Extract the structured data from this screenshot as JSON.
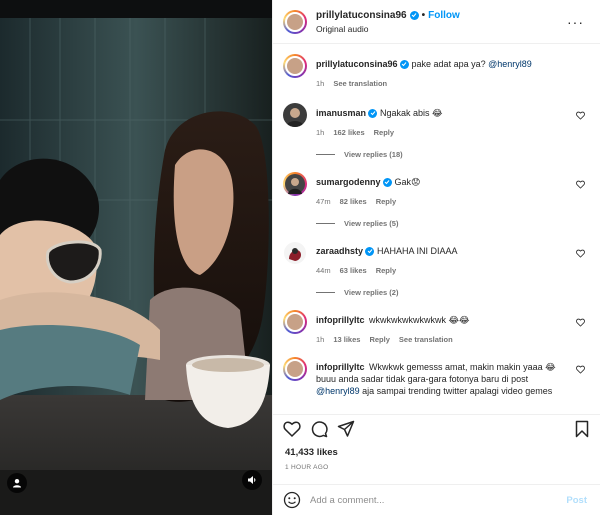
{
  "post": {
    "username": "prillylatuconsina96",
    "separator": "•",
    "follow_label": "Follow",
    "audio_label": "Original audio",
    "more_glyph": "···"
  },
  "caption": {
    "username": "prillylatuconsina96",
    "text": "pake adat apa ya? ",
    "mention": "@henryl89",
    "time": "1h",
    "see_translation": "See translation"
  },
  "comments": [
    {
      "username": "imanusman",
      "text": "Ngakak abis 😂",
      "time": "1h",
      "likes": "162 likes",
      "reply": "Reply",
      "view_replies": "View replies (18)"
    },
    {
      "username": "sumargodenny",
      "text": "Gak😟",
      "time": "47m",
      "likes": "82 likes",
      "reply": "Reply",
      "view_replies": "View replies (5)"
    },
    {
      "username": "zaraadhsty",
      "text": "HAHAHA INI DIAAA",
      "time": "44m",
      "likes": "63 likes",
      "reply": "Reply",
      "view_replies": "View replies (2)"
    },
    {
      "username": "infoprillyltc",
      "text": "wkwkwkwkwkwkwk 😂😂",
      "time": "1h",
      "likes": "13 likes",
      "reply": "Reply",
      "see_translation": "See translation"
    },
    {
      "username": "infoprillyltc",
      "text": "Wkwkwk gemesss amat, makin makin yaaa 😂 buuu anda sadar tidak gara-gara fotonya baru di post ",
      "mention": "@henryl89",
      "text_after": " aja sampai trending twitter apalagi video gemes"
    }
  ],
  "footer": {
    "likes": "41,433 likes",
    "time": "1 HOUR AGO",
    "comment_placeholder": "Add a comment...",
    "post_label": "Post"
  },
  "colors": {
    "accent": "#0095f6",
    "muted": "#737373",
    "post_disabled": "#b2dffc"
  }
}
